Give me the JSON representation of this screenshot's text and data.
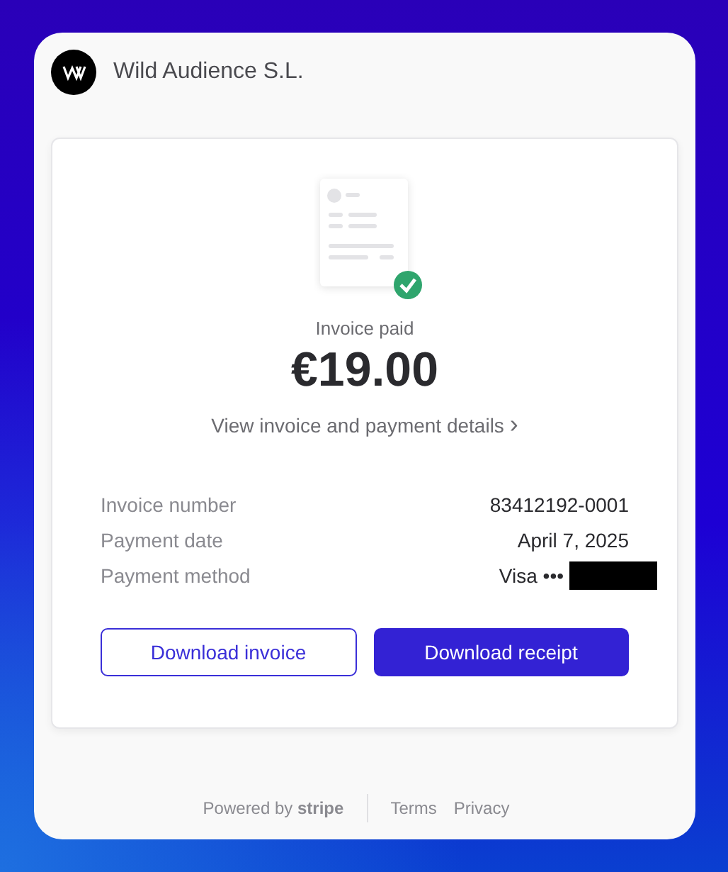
{
  "merchant": {
    "name": "Wild Audience S.L."
  },
  "receipt": {
    "status": "Invoice paid",
    "amount": "€19.00",
    "details_link": "View invoice and payment details",
    "details_chevron": "›"
  },
  "details": [
    {
      "label": "Invoice number",
      "value": "83412192-0001",
      "redacted": false
    },
    {
      "label": "Payment date",
      "value": "April 7, 2025",
      "redacted": false
    },
    {
      "label": "Payment method",
      "value": "Visa •••",
      "redacted": true
    }
  ],
  "buttons": [
    {
      "label": "Download invoice",
      "kind": "secondary"
    },
    {
      "label": "Download receipt",
      "kind": "primary"
    }
  ],
  "footer": {
    "powered_by": "Powered by **stripe**",
    "links": [
      "Terms",
      "Privacy"
    ]
  }
}
